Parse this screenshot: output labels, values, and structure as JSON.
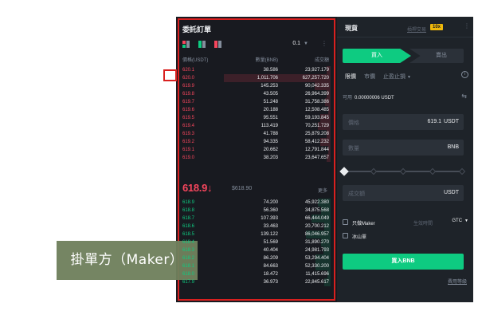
{
  "order_book": {
    "title": "委託訂單",
    "precision": "0.1",
    "columns": {
      "price": "價格(USDT)",
      "amount": "數量(BNB)",
      "total": "成交額"
    },
    "asks": [
      {
        "price": "620.1",
        "amount": "38.586",
        "total": "23,927.179",
        "depth": 0.04
      },
      {
        "price": "620.0",
        "amount": "1,011.706",
        "total": "627,257.720",
        "depth": 1.0
      },
      {
        "price": "619.9",
        "amount": "145.253",
        "total": "90,042.335",
        "depth": 0.15
      },
      {
        "price": "619.8",
        "amount": "43.505",
        "total": "26,964.399",
        "depth": 0.04
      },
      {
        "price": "619.7",
        "amount": "51.248",
        "total": "31,758.386",
        "depth": 0.05
      },
      {
        "price": "619.6",
        "amount": "20.188",
        "total": "12,508.485",
        "depth": 0.02
      },
      {
        "price": "619.5",
        "amount": "95.551",
        "total": "59,193.845",
        "depth": 0.1
      },
      {
        "price": "619.4",
        "amount": "113.419",
        "total": "70,251.729",
        "depth": 0.12
      },
      {
        "price": "619.3",
        "amount": "41.788",
        "total": "25,879.208",
        "depth": 0.04
      },
      {
        "price": "619.2",
        "amount": "94.335",
        "total": "58,412.232",
        "depth": 0.1
      },
      {
        "price": "619.1",
        "amount": "20.662",
        "total": "12,791.844",
        "depth": 0.02
      },
      {
        "price": "619.0",
        "amount": "38.203",
        "total": "23,647.657",
        "depth": 0.04
      }
    ],
    "last_price": "618.9",
    "last_price_arrow": "↓",
    "mark_price": "$618.90",
    "more_label": "更多",
    "bids": [
      {
        "price": "618.9",
        "amount": "74.200",
        "total": "45,922.380",
        "depth": 0.12
      },
      {
        "price": "618.8",
        "amount": "56.360",
        "total": "34,875.568",
        "depth": 0.09
      },
      {
        "price": "618.7",
        "amount": "107.393",
        "total": "66,444.049",
        "depth": 0.18
      },
      {
        "price": "618.6",
        "amount": "33.463",
        "total": "20,700.212",
        "depth": 0.06
      },
      {
        "price": "618.5",
        "amount": "139.122",
        "total": "86,046.957",
        "depth": 0.23
      },
      {
        "price": "618.4",
        "amount": "51.569",
        "total": "31,890.270",
        "depth": 0.09
      },
      {
        "price": "618.3",
        "amount": "40.404",
        "total": "24,981.793",
        "depth": 0.07
      },
      {
        "price": "618.2",
        "amount": "86.209",
        "total": "53,294.404",
        "depth": 0.14
      },
      {
        "price": "618.1",
        "amount": "84.663",
        "total": "52,330.200",
        "depth": 0.14
      },
      {
        "price": "618.0",
        "amount": "18.472",
        "total": "11,415.696",
        "depth": 0.03
      },
      {
        "price": "617.9",
        "amount": "36.973",
        "total": "22,845.617",
        "depth": 0.06
      }
    ]
  },
  "trade_panel": {
    "tab_spot": "現貨",
    "tab_margin": "槓桿交易",
    "leverage_badge": "10x",
    "buy_label": "買入",
    "sell_label": "賣出",
    "order_types": {
      "limit": "限價",
      "market": "市價",
      "stop_limit": "止盈止損"
    },
    "available_label": "可用",
    "available_value": "0.00000006 USDT",
    "price_label": "價格",
    "price_value": "619.1",
    "price_unit": "USDT",
    "qty_label": "數量",
    "qty_unit": "BNB",
    "slider_position": 0,
    "total_label": "成交額",
    "total_unit": "USDT",
    "maker_only_label": "只做Maker",
    "iceberg_label": "冰山單",
    "tif_label": "生效時間",
    "tif_value": "GTC",
    "submit_label": "買入BNB",
    "fee_link": "費用等級"
  },
  "caption": "掛單方（Maker）",
  "colors": {
    "ask": "#f6465d",
    "bid": "#0ecb81",
    "highlight_border": "#d9201f",
    "caption_bg": "#6f805d",
    "leverage_badge": "#f0b90b"
  }
}
